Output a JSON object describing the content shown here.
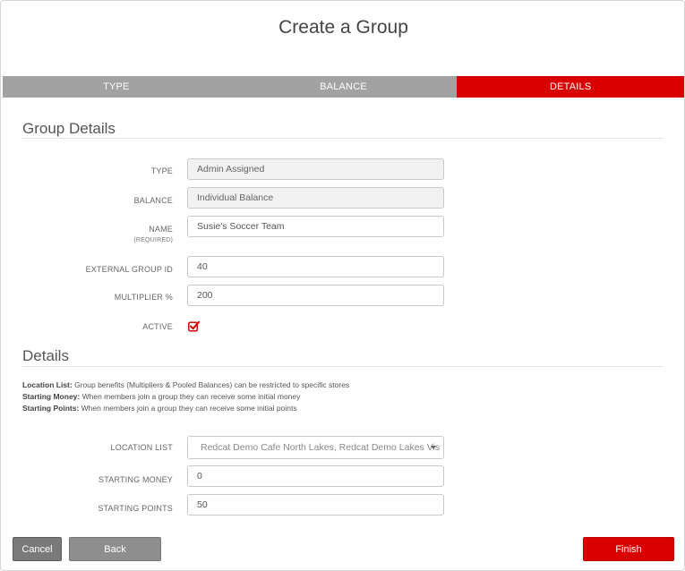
{
  "header": {
    "title": "Create a Group"
  },
  "steps": [
    {
      "label": "TYPE",
      "active": false
    },
    {
      "label": "BALANCE",
      "active": false
    },
    {
      "label": "DETAILS",
      "active": true
    }
  ],
  "group_details": {
    "heading": "Group Details",
    "type": {
      "label": "TYPE",
      "value": "Admin Assigned"
    },
    "balance": {
      "label": "BALANCE",
      "value": "Individual Balance"
    },
    "name": {
      "label": "NAME",
      "sub_label": "(REQUIRED)",
      "value": "Susie's Soccer Team"
    },
    "external_id": {
      "label": "EXTERNAL GROUP ID",
      "value": "40"
    },
    "multiplier": {
      "label": "MULTIPLIER %",
      "value": "200"
    },
    "active": {
      "label": "ACTIVE",
      "checked": true
    }
  },
  "details": {
    "heading": "Details",
    "notes": [
      {
        "term": "Location List:",
        "text": " Group benefits (Multipliers & Pooled Balances) can be restricted to specific stores"
      },
      {
        "term": "Starting Money:",
        "text": " When members join a group they can receive some initial money"
      },
      {
        "term": "Starting Points:",
        "text": " When members join a group they can receive some initial points"
      }
    ],
    "location_list": {
      "label": "LOCATION LIST",
      "value": "Redcat Demo Cafe North Lakes, Redcat Demo Lakes Vis"
    },
    "starting_money": {
      "label": "STARTING MONEY",
      "value": "0"
    },
    "starting_points": {
      "label": "STARTING POINTS",
      "value": "50"
    }
  },
  "footer": {
    "cancel_label": "Cancel",
    "back_label": "Back",
    "finish_label": "Finish"
  },
  "colors": {
    "accent": "#d80000",
    "step_inactive": "#a2a2a2"
  }
}
